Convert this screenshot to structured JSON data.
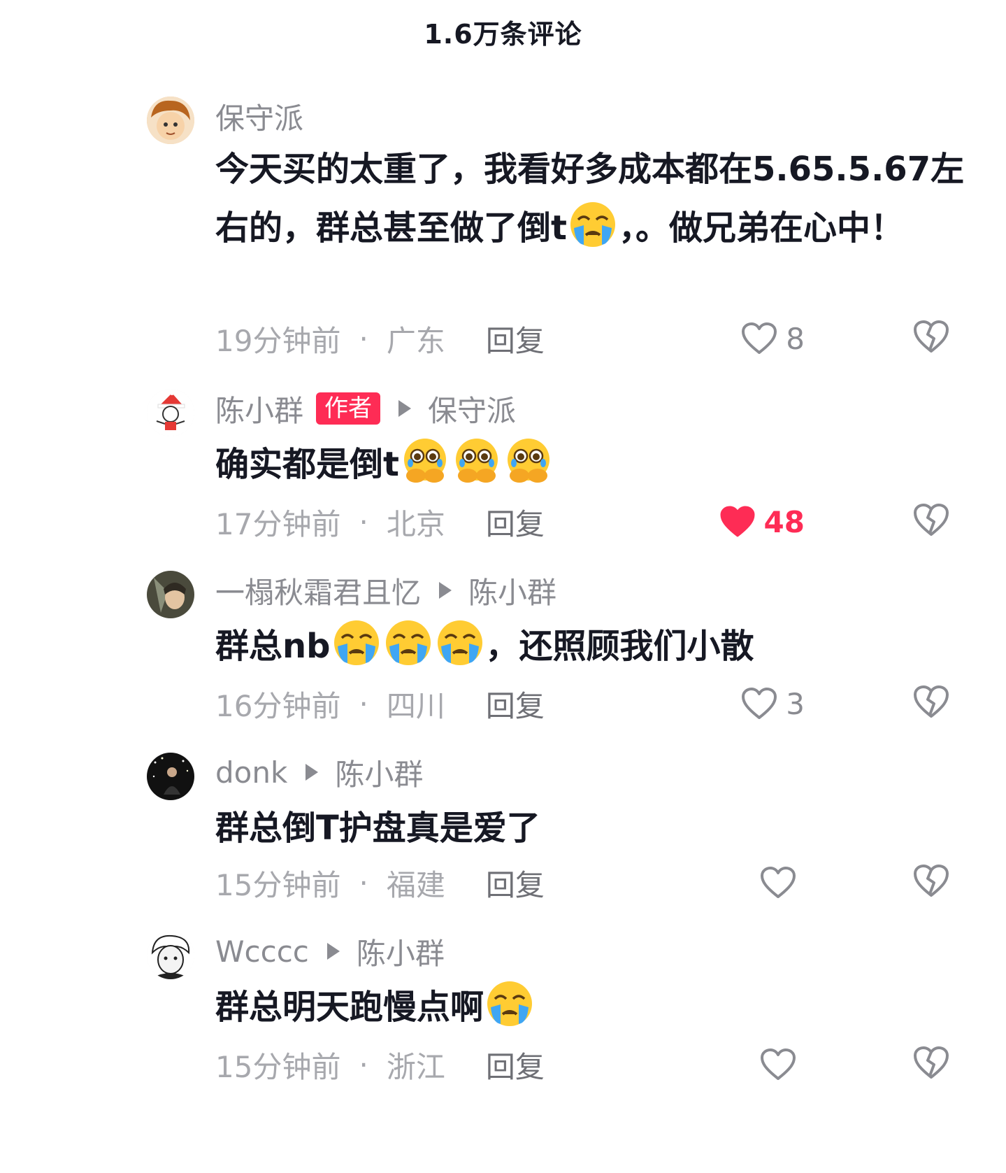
{
  "header": {
    "title": "1.6万条评论"
  },
  "colors": {
    "accent": "#fe2c55",
    "muted": "#8a8b91"
  },
  "comments": [
    {
      "user": "保守派",
      "text_parts": [
        "今天买的太重了，我看好多成本都在5.65.5.67左右的，群总甚至做了倒t",
        "，。做兄弟在心中！"
      ],
      "emoji_icon": "loudly-crying-face",
      "time": "19分钟前",
      "location": "广东",
      "reply_label": "回复",
      "likes": "8",
      "liked": false
    },
    {
      "user": "陈小群",
      "badge": "作者",
      "reply_to": "保守派",
      "text_parts": [
        "确实都是倒t",
        ""
      ],
      "emoji_icon": "face-holding-back-tears",
      "time": "17分钟前",
      "location": "北京",
      "reply_label": "回复",
      "likes": "48",
      "liked": true
    },
    {
      "user": "一榻秋霜君且忆",
      "reply_to": "陈小群",
      "text_parts": [
        "群总nb",
        "，还照顾我们小散"
      ],
      "emoji_icon": "loudly-crying-face",
      "time": "16分钟前",
      "location": "四川",
      "reply_label": "回复",
      "likes": "3",
      "liked": false
    },
    {
      "user": "donk",
      "reply_to": "陈小群",
      "text_parts": [
        "群总倒T护盘真是爱了",
        ""
      ],
      "time": "15分钟前",
      "location": "福建",
      "reply_label": "回复",
      "likes": "",
      "liked": false
    },
    {
      "user": "Wcccc",
      "reply_to": "陈小群",
      "text_parts": [
        "群总明天跑慢点啊",
        ""
      ],
      "emoji_icon": "loudly-crying-face",
      "time": "15分钟前",
      "location": "浙江",
      "reply_label": "回复",
      "likes": "",
      "liked": false
    }
  ]
}
